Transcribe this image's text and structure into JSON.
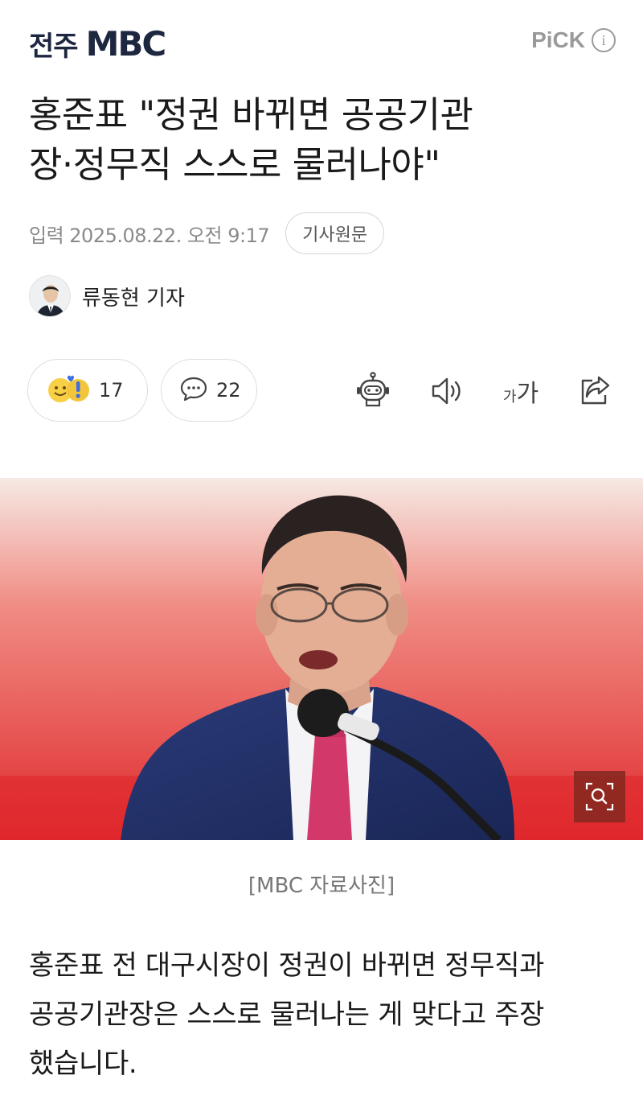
{
  "header": {
    "brand_local": "전주",
    "brand_logo": "MBC",
    "pick_label": "PiCK",
    "info_icon": "i"
  },
  "article": {
    "headline_line1": "홍준표 \"정권 바뀌면 공공기관",
    "headline_line2": "장·정무직 스스로 물러나야\"",
    "date": "입력 2025.08.22. 오전 9:17",
    "source_button": "기사원문",
    "author": "류동현 기자",
    "reactions_count": "17",
    "comments_count": "22",
    "font_size_label": "가가",
    "photo_caption": "[MBC 자료사진]",
    "body_line1": "홍준표 전 대구시장이 정권이 바뀌면 정무직과",
    "body_line2": "공공기관장은 스스로 물러나는 게 맞다고 주장",
    "body_line3": "했습니다."
  },
  "icons": {
    "reaction": "smiley-reaction-icon",
    "comment": "speech-bubble-icon",
    "summary_bot": "robot-icon",
    "audio": "speaker-icon",
    "font_size": "font-size-icon",
    "share": "share-icon",
    "zoom": "zoom-icon"
  },
  "colors": {
    "brand": "#1d2740",
    "photo_background": "#e23a3a",
    "text": "#1a1a1a",
    "muted": "#8a8a8a"
  }
}
